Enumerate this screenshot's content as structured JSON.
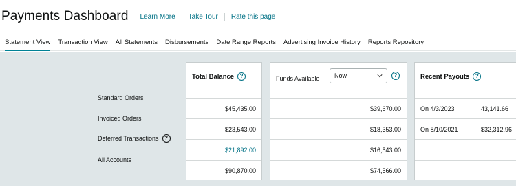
{
  "header": {
    "title": "Payments Dashboard",
    "links": [
      "Learn More",
      "Take Tour",
      "Rate this page"
    ]
  },
  "tabs": [
    {
      "label": "Statement View",
      "active": true
    },
    {
      "label": "Transaction View",
      "active": false
    },
    {
      "label": "All Statements",
      "active": false
    },
    {
      "label": "Disbursements",
      "active": false
    },
    {
      "label": "Date Range Reports",
      "active": false
    },
    {
      "label": "Advertising Invoice History",
      "active": false
    },
    {
      "label": "Reports Repository",
      "active": false
    }
  ],
  "rows": {
    "standard": "Standard Orders",
    "invoiced": "Invoiced Orders",
    "deferred": "Deferred Transactions",
    "all": "All Accounts"
  },
  "total_balance": {
    "title": "Total Balance",
    "standard": "$45,435.00",
    "invoiced": "$23,543.00",
    "deferred": "$21,892.00",
    "all": "$90,870.00"
  },
  "funds_available": {
    "label": "Funds Available",
    "selected": "Now",
    "standard": "$39,670.00",
    "invoiced": "$18,353.00",
    "deferred": "$16,543.00",
    "all": "$74,566.00"
  },
  "recent_payouts": {
    "title": "Recent Payouts",
    "items": [
      {
        "date": "On 4/3/2023",
        "amount": "43,141.66"
      },
      {
        "date": "On 8/10/2021",
        "amount": "$32,312.96"
      }
    ]
  },
  "colors": {
    "accent": "#008296",
    "link": "#007185",
    "panel_bg": "#dfe6e8"
  },
  "icons": {
    "help": "question-circle-icon",
    "dropdown": "chevron-down-icon"
  }
}
